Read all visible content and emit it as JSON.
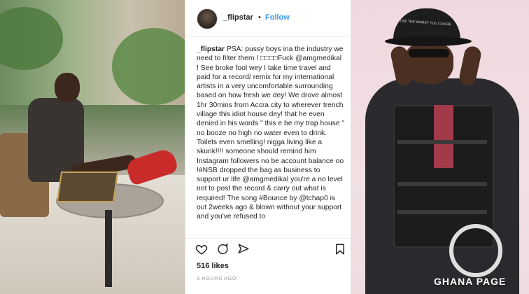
{
  "post": {
    "username": "_flipstar",
    "separator": "•",
    "follow_label": "Follow",
    "caption_user": "_flipstar",
    "caption_text": "PSA: pussy boys ina the industry we need to filter them ! □□□□Fuck @amgmedikal ! See broke fool wey I take time travel and paid for a record/ remix for my international artists in a very uncomfortable surrounding based on how fresh we dey! We drove almost 1hr 30mins from Accra city to wherever trench village this idiot house dey! that he even denied in his words \" this e be my trap house \" no booze no high no water even to drink. Toilets even smelling! nigga living like a skunk!!!! someone should remind him Instagram followers no be account balance oo !#NSB dropped the bag as business to support ur life @amgmedikal you're a no level not to post the record & carry out what is required! The song #Bounce by @tchap0 is out 2weeks ago & blown without your support and you've refused to",
    "likes": "516 likes",
    "timestamp": "3 HOURS AGO"
  },
  "watermark": {
    "brand": "GHANA PAGE"
  },
  "right_photo": {
    "hat_text": "I BE THE WORST YOU CAN BE"
  },
  "colors": {
    "link_blue": "#3897f0",
    "text_dark": "#262626",
    "muted": "#999999"
  }
}
